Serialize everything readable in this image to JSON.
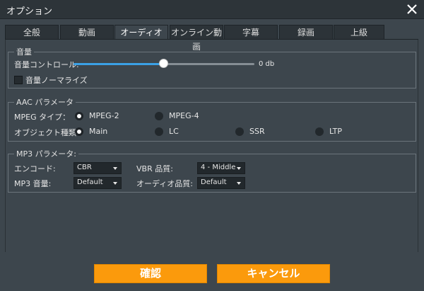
{
  "window": {
    "title": "オプション"
  },
  "tabs": [
    {
      "label": "全般"
    },
    {
      "label": "動画"
    },
    {
      "label": "オーディオ"
    },
    {
      "label": "オンライン動画"
    },
    {
      "label": "字幕"
    },
    {
      "label": "録画"
    },
    {
      "label": "上級"
    }
  ],
  "active_tab": "オーディオ",
  "volume": {
    "title": "音量",
    "control_label": "音量コントロール:",
    "slider_level": 0.5,
    "value_text": "0 db",
    "normalize_label": "音量ノーマライズ",
    "normalize_checked": false
  },
  "aac": {
    "title": "AAC パラメータ",
    "mpeg_type_label": "MPEG タイプ：",
    "mpeg_options": [
      "MPEG-2",
      "MPEG-4"
    ],
    "mpeg_selected": "MPEG-2",
    "object_type_label": "オブジェクト種類:",
    "object_options": [
      "Main",
      "LC",
      "SSR",
      "LTP"
    ],
    "object_selected": "Main"
  },
  "mp3": {
    "title": "MP3 パラメータ:",
    "encode_label": "エンコード:",
    "encode_value": "CBR",
    "vbr_label": "VBR 品質:",
    "vbr_value": "4 - Middle",
    "volume_label": "MP3 音量:",
    "volume_value": "Default",
    "audio_quality_label": "オーディオ品質:",
    "audio_quality_value": "Default"
  },
  "buttons": {
    "ok": "確認",
    "cancel": "キャンセル"
  },
  "colors": {
    "accent_button": "#fb9a0c",
    "slider_fill": "#3ba1e6",
    "background": "#3d464d"
  }
}
